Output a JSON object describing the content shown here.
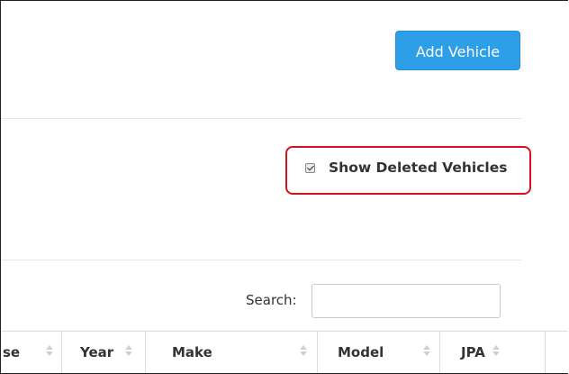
{
  "toolbar": {
    "add_vehicle_label": "Add Vehicle",
    "accent_color": "#2d9ee8"
  },
  "filters": {
    "show_deleted_label": "Show Deleted Vehicles",
    "show_deleted_checked": true,
    "highlight_color": "#d4101f"
  },
  "search": {
    "label": "Search:",
    "value": "",
    "placeholder": ""
  },
  "table": {
    "columns": [
      {
        "label": "se",
        "sort_icon": "sort-both-icon"
      },
      {
        "label": "Year",
        "sort_icon": "sort-both-icon"
      },
      {
        "label": "Make",
        "sort_icon": "sort-both-icon"
      },
      {
        "label": "Model",
        "sort_icon": "sort-both-icon"
      },
      {
        "label": "JPA",
        "sort_icon": "sort-both-icon"
      }
    ]
  }
}
